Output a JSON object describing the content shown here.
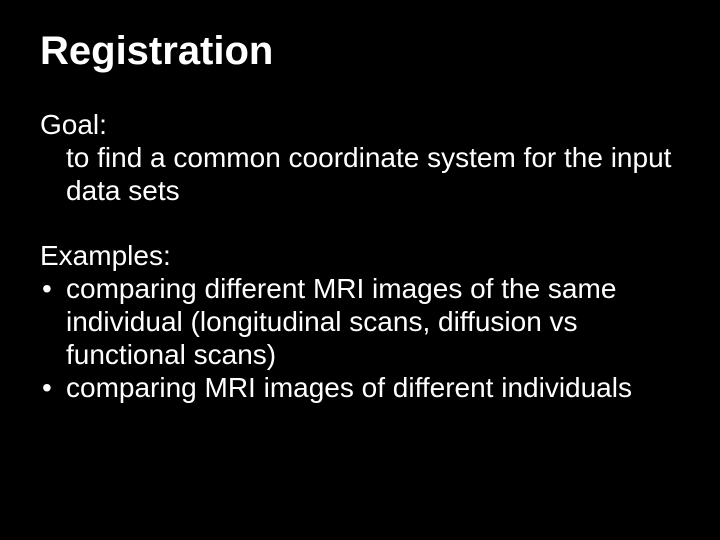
{
  "title": "Registration",
  "goal": {
    "label": "Goal:",
    "text": "to find a common coordinate system for the input data sets"
  },
  "examples": {
    "label": "Examples:",
    "items": [
      "comparing different MRI images of the same individual (longitudinal scans, diffusion vs functional scans)",
      "comparing MRI images of different individuals"
    ]
  }
}
